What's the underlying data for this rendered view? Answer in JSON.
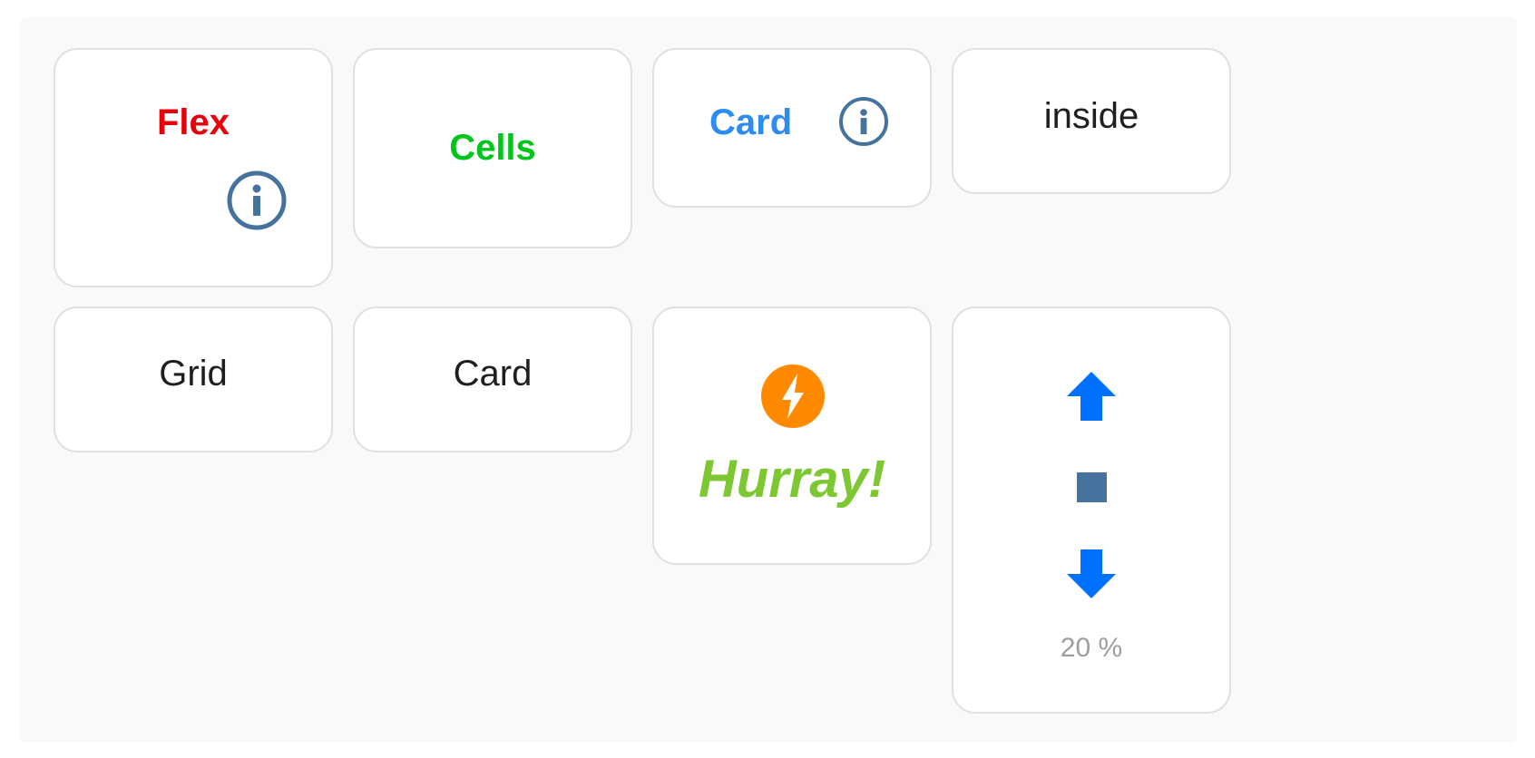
{
  "cards": {
    "flex": {
      "label": "Flex",
      "color": "#e8000b",
      "icon": "info-icon"
    },
    "cells": {
      "label": "Cells",
      "color": "#00c51a"
    },
    "card_info": {
      "label": "Card",
      "color": "#2d8cf0",
      "icon": "info-icon"
    },
    "inside": {
      "label": "inside",
      "color": "#1f1f1f"
    },
    "grid": {
      "label": "Grid",
      "color": "#1f1f1f"
    },
    "card_plain": {
      "label": "Card",
      "color": "#1f1f1f"
    },
    "hurray": {
      "label": "Hurray!",
      "color": "#7dc832",
      "icon": "lightning-icon",
      "icon_color": "#ff8a00"
    },
    "controls": {
      "up_icon": "arrow-up-icon",
      "stop_icon": "stop-square-icon",
      "down_icon": "arrow-down-icon",
      "value_text": "20 %",
      "arrow_color": "#0070ff",
      "stop_color": "#46729e"
    }
  },
  "colors": {
    "info_icon": "#46729e",
    "card_border": "#e0e0e0",
    "panel_background": "#f9f9f9",
    "muted_text": "#9e9e9e"
  }
}
